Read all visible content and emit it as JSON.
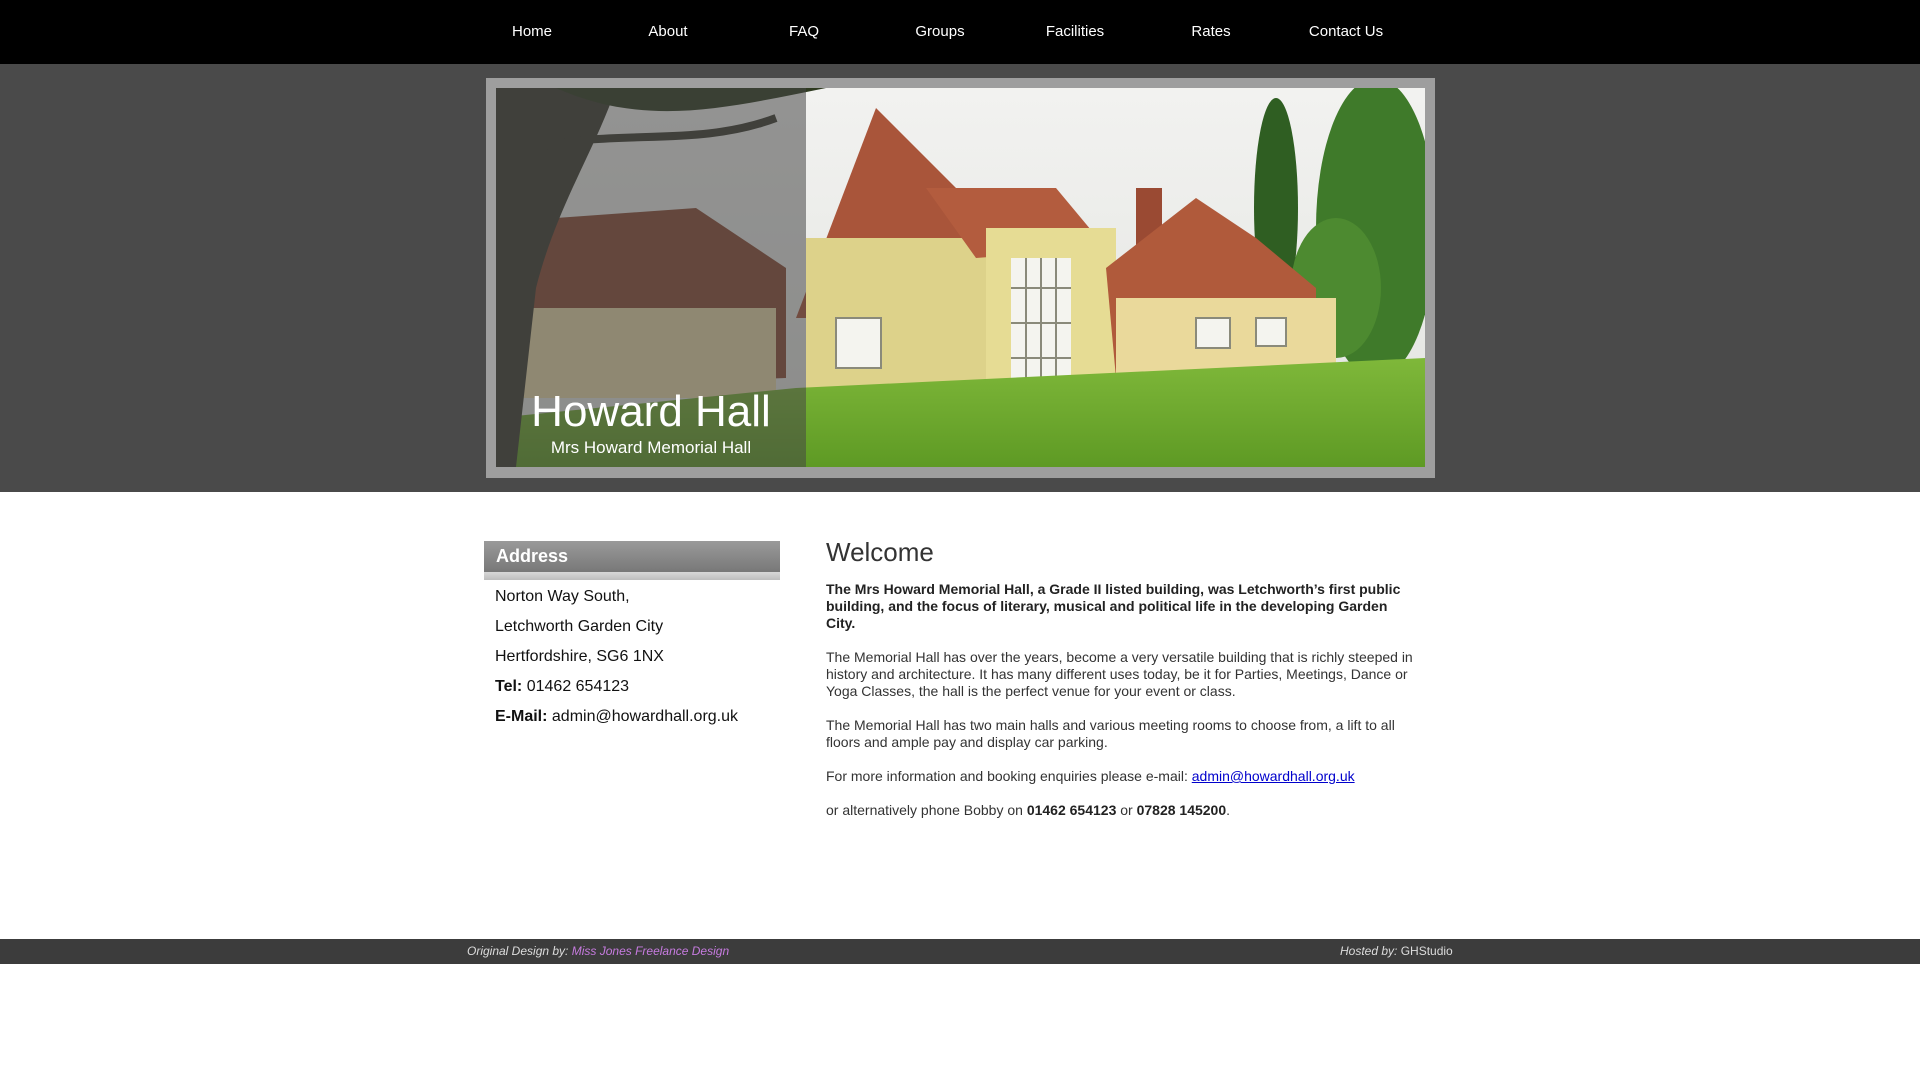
{
  "nav": {
    "items": [
      "Home",
      "About",
      "FAQ",
      "Groups",
      "Facilities",
      "Rates",
      "Contact Us"
    ]
  },
  "banner": {
    "title": "Howard Hall",
    "subtitle": "Mrs Howard Memorial Hall"
  },
  "address": {
    "heading": "Address",
    "line1": "Norton Way South,",
    "line2": "Letchworth Garden City",
    "line3": "Hertfordshire, SG6 1NX",
    "tel_label": "Tel:",
    "tel_value": "01462 654123",
    "email_label": "E-Mail:",
    "email_value": "admin@howardhall.org.uk"
  },
  "welcome": {
    "title": "Welcome",
    "intro": "The Mrs Howard Memorial Hall, a Grade II listed building, was Letchworth’s first public building, and the focus of literary, musical and political life in the developing Garden City.",
    "para1": "The Memorial Hall has over the years, become a very versatile building that is richly steeped in history and architecture. It has many different uses today, be it for Parties, Meetings, Dance or Yoga Classes, the hall is the perfect venue for your event or class.",
    "para2": "The Memorial Hall has two main halls and various meeting rooms to choose from, a lift to all floors and ample pay and display car parking.",
    "enquiry_text": "For more information and booking enquiries please e-mail: ",
    "enquiry_email": "admin@howardhall.org.uk",
    "phone_text1": "or alternatively phone Bobby on ",
    "phone1": "01462 654123",
    "phone_text2": " or ",
    "phone2": "07828 145200",
    "phone_text3": "."
  },
  "footer": {
    "design_label": "Original Design by: ",
    "design_link": "Miss Jones Freelance Design",
    "hosted_label": "Hosted by: ",
    "hosted_value": "GHStudio"
  }
}
